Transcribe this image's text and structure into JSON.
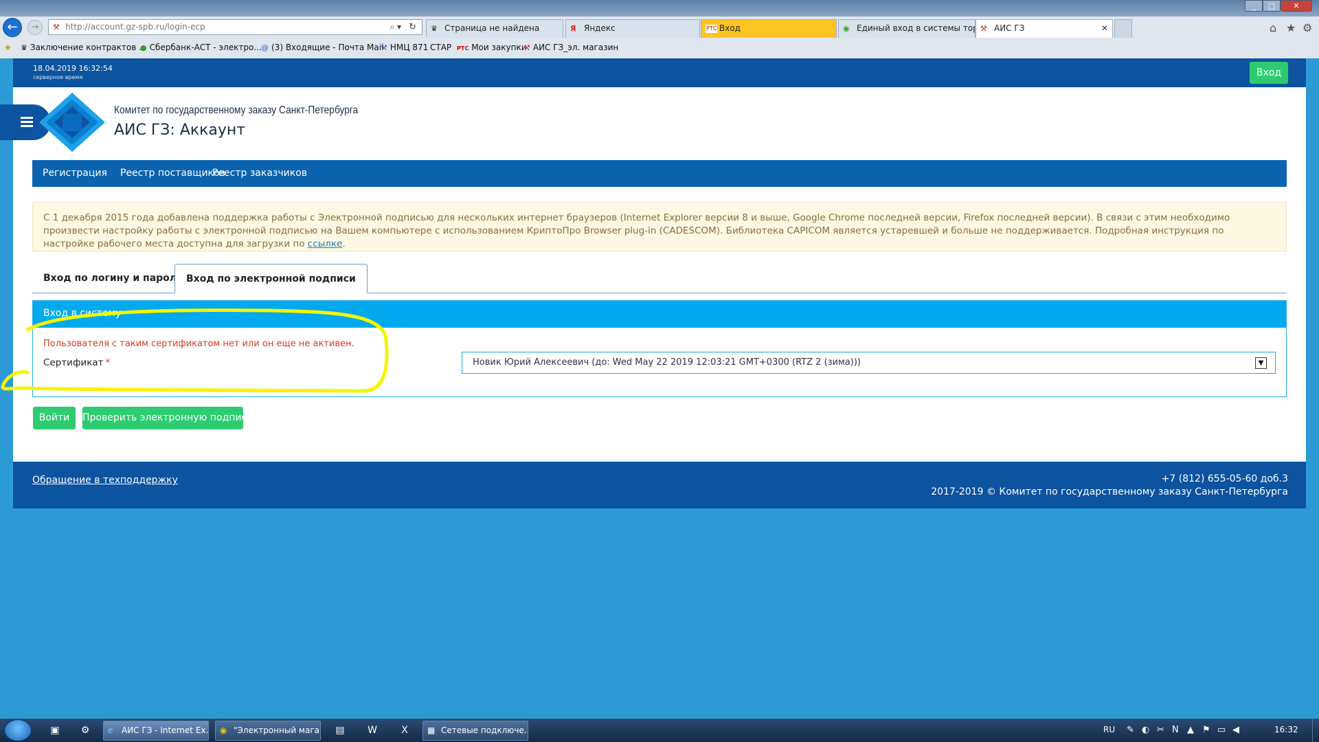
{
  "browser": {
    "address": "http://account.gz-spb.ru/login-ecp",
    "tabs": [
      {
        "label": "Страница не найдена",
        "icon": "coat-of-arms-icon"
      },
      {
        "label": "Яндекс",
        "icon": "yandex-icon"
      },
      {
        "label": "Вход",
        "icon": "rts-icon"
      },
      {
        "label": "Единый вход в системы торго...",
        "icon": "globe-icon"
      },
      {
        "label": "АИС ГЗ",
        "icon": "tools-icon"
      }
    ],
    "favorites": [
      {
        "label": "Заключение контрактов ...",
        "icon": "coat-of-arms-icon"
      },
      {
        "label": "Сбербанк-АСТ - электро...",
        "icon": "sberbank-icon"
      },
      {
        "label": "(3) Входящие - Почта Mail",
        "icon": "mail-icon"
      },
      {
        "label": "НМЦ 871",
        "icon": "tools-icon"
      },
      {
        "label": "СТАР",
        "icon": ""
      },
      {
        "label": "Мои закупки",
        "icon": "rts-icon"
      },
      {
        "label": "АИС ГЗ_эл. магазин",
        "icon": "tools-icon"
      }
    ],
    "rts_badge": "РТС"
  },
  "page": {
    "server_date": "18.04.2019 16:32:54",
    "server_label": "серверное время",
    "login_button": "Вход",
    "org_name": "Комитет по государственному заказу Санкт-Петербурга",
    "site_title": "АИС ГЗ: Аккаунт",
    "nav": [
      "Регистрация",
      "Реестр поставщиков",
      "Реестр заказчиков"
    ],
    "notice": {
      "text": "С 1 декабря 2015 года добавлена поддержка работы с Электронной подписью для нескольких интернет браузеров (Internet Explorer версии 8 и выше, Google Chrome последней версии, Firefox последней версии). В связи с этим необходимо произвести настройку работы с электронной подписью на Вашем компьютере с использованием КриптоПро Browser plug-in (CADESCOM). Библиотека CAPICOM является устаревшей и больше не поддерживается. Подробная инструкция по настройке рабочего места доступна для загрузки по ",
      "link": "ссылке",
      "end": "."
    },
    "login_tabs": {
      "password": "Вход по логину и паролю",
      "ecp": "Вход по электронной подписи"
    },
    "panel": {
      "title": "Вход в систему",
      "error": "Пользователя с таким сертификатом нет или он еще не активен.",
      "cert_label": "Сертификат",
      "required_mark": "*",
      "cert_value": "Новик Юрий Алексеевич (до: Wed May 22 2019 12:03:21 GMT+0300 (RTZ 2 (зима)))"
    },
    "buttons": {
      "login": "Войти",
      "check": "Проверить электронную подпись"
    },
    "footer": {
      "support": "Обращение в техподдержку",
      "phone": "+7 (812) 655-05-60 доб.3",
      "copyright": "2017-2019 © Комитет по государственному заказу Санкт-Петербурга"
    },
    "colors": {
      "header": "#0c53a0",
      "nav": "#0c63b0",
      "panel_head": "#03a9ef",
      "green": "#2ecc71",
      "highlight": "#f5f500"
    }
  },
  "taskbar": {
    "tasks": [
      {
        "label": "АИС ГЗ - Internet Ex...",
        "icon": "ie-icon"
      },
      {
        "label": "\"Электронный мага...",
        "icon": "chrome-icon"
      },
      {
        "label": "Сетевые подключе...",
        "icon": "network-icon"
      }
    ],
    "lang": "RU",
    "clock": "16:32"
  }
}
